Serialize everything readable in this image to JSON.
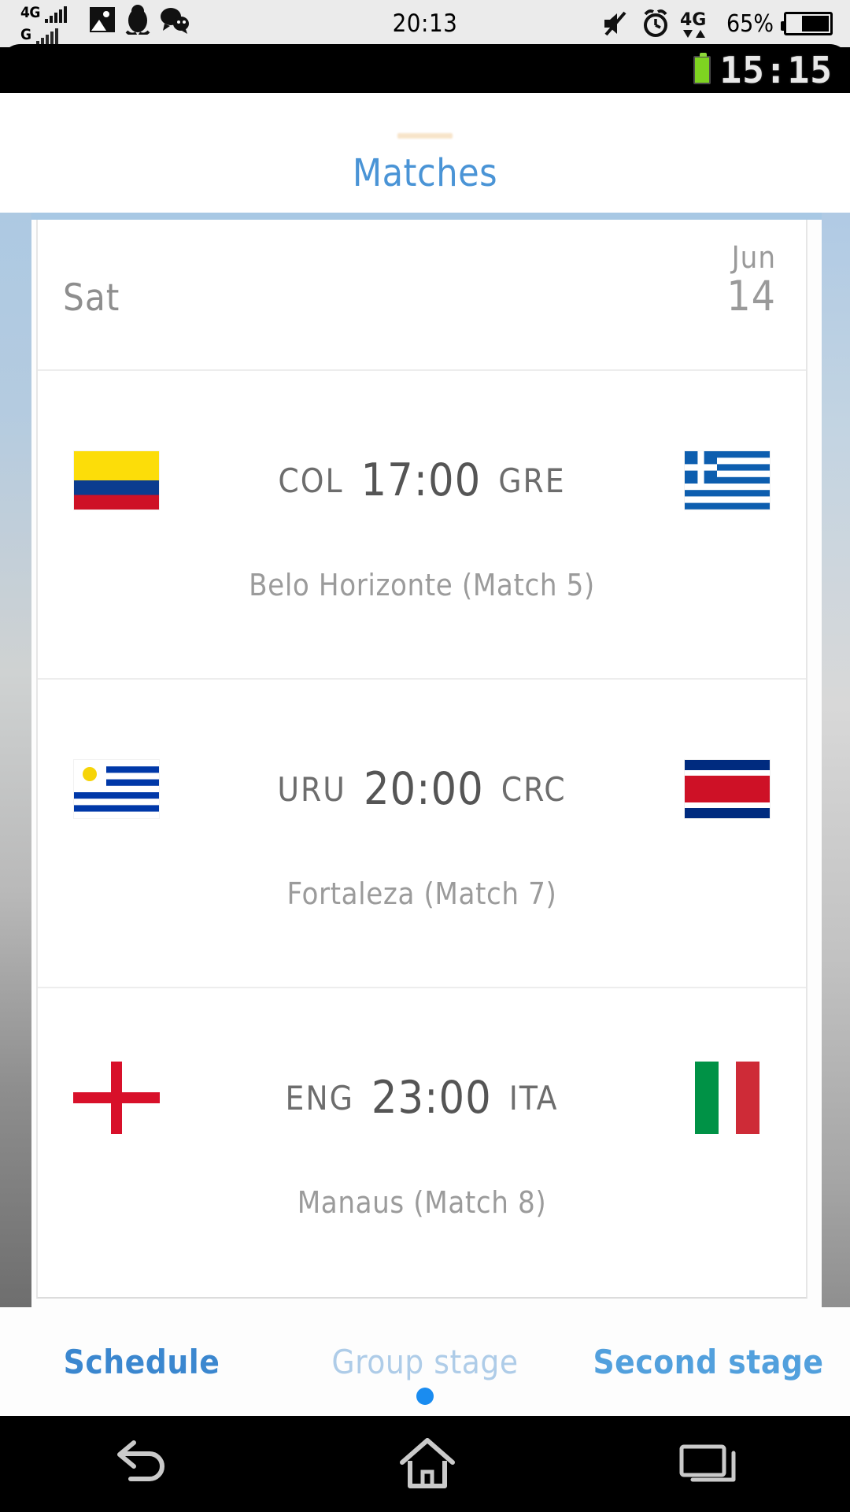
{
  "host_status": {
    "net_primary": "4G",
    "net_secondary": "G",
    "clock": "20:13",
    "battery_percent": "65%",
    "icons": [
      "photo-icon",
      "penguin-icon",
      "chat-icon",
      "mute-icon",
      "alarm-icon",
      "data-4g-icon",
      "battery-icon"
    ]
  },
  "inner_status": {
    "clock": "15:15",
    "battery": "battery-icon"
  },
  "app": {
    "title": "Matches",
    "date_header": {
      "day_of_week": "Sat",
      "month": "Jun",
      "day": "14"
    },
    "matches": [
      {
        "home_abbr": "COL",
        "home_flag": "colombia-flag",
        "time": "17:00",
        "away_abbr": "GRE",
        "away_flag": "greece-flag",
        "venue": "Belo Horizonte (Match  5)"
      },
      {
        "home_abbr": "URU",
        "home_flag": "uruguay-flag",
        "time": "20:00",
        "away_abbr": "CRC",
        "away_flag": "costa-rica-flag",
        "venue": "Fortaleza (Match  7)"
      },
      {
        "home_abbr": "ENG",
        "home_flag": "england-flag",
        "time": "23:00",
        "away_abbr": "ITA",
        "away_flag": "italy-flag",
        "venue": "Manaus (Match  8)"
      }
    ],
    "tabs": [
      {
        "label": "Schedule",
        "state": "active"
      },
      {
        "label": "Group stage",
        "state": "dim"
      },
      {
        "label": "Second stage",
        "state": "norm"
      }
    ]
  },
  "navbar": {
    "back": "back-icon",
    "home": "home-icon",
    "recents": "recents-icon"
  },
  "colors": {
    "accent_blue": "#3b87cf",
    "title_blue": "#4a94d6",
    "sheet_border": "#a8c8e4",
    "dot": "#1a8cf0"
  }
}
